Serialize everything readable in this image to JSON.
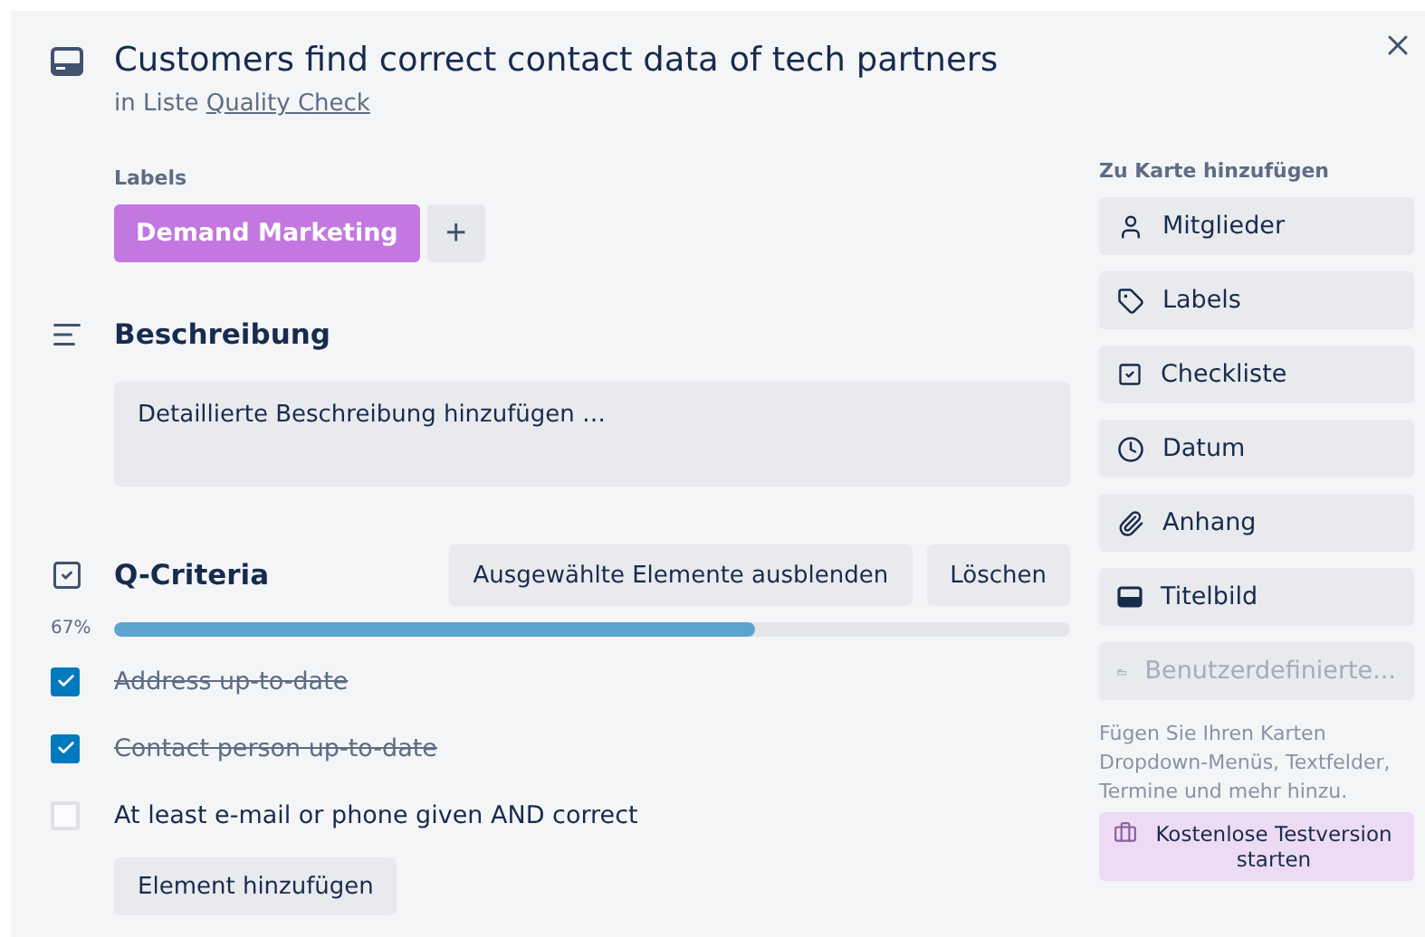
{
  "card": {
    "title": "Customers find correct contact data of tech partners",
    "list_prefix": "in Liste",
    "list_name": "Quality Check"
  },
  "labels": {
    "heading": "Labels",
    "items": [
      {
        "text": "Demand Marketing",
        "color": "#c377e0"
      }
    ],
    "add": "+"
  },
  "description": {
    "heading": "Beschreibung",
    "placeholder": "Detaillierte Beschreibung hinzufügen …"
  },
  "checklist": {
    "title": "Q-Criteria",
    "hide_button": "Ausgewählte Elemente ausblenden",
    "delete_button": "Löschen",
    "percent": "67%",
    "level": 0.67,
    "items": [
      {
        "text": "Address up-to-date",
        "checked": true
      },
      {
        "text": "Contact person up-to-date",
        "checked": true
      },
      {
        "text": "At least e-mail or phone given AND correct",
        "checked": false
      }
    ],
    "add_button": "Element hinzufügen"
  },
  "sidebar": {
    "heading": "Zu Karte hinzufügen",
    "buttons": [
      {
        "label": "Mitglieder",
        "kind": "person",
        "disabled": false
      },
      {
        "label": "Labels",
        "kind": "tag",
        "disabled": false
      },
      {
        "label": "Checkliste",
        "kind": "checkbox",
        "disabled": false
      },
      {
        "label": "Datum",
        "kind": "clock",
        "disabled": false
      },
      {
        "label": "Anhang",
        "kind": "paperclip",
        "disabled": false
      },
      {
        "label": "Titelbild",
        "kind": "cover",
        "disabled": false
      },
      {
        "label": "Benutzerdefinierte...",
        "kind": "fields",
        "disabled": true
      }
    ],
    "hint": "Fügen Sie Ihren Karten Dropdown-Menüs, Textfelder, Termine und mehr hinzu.",
    "trial_button": "Kostenlose Testversion starten"
  }
}
